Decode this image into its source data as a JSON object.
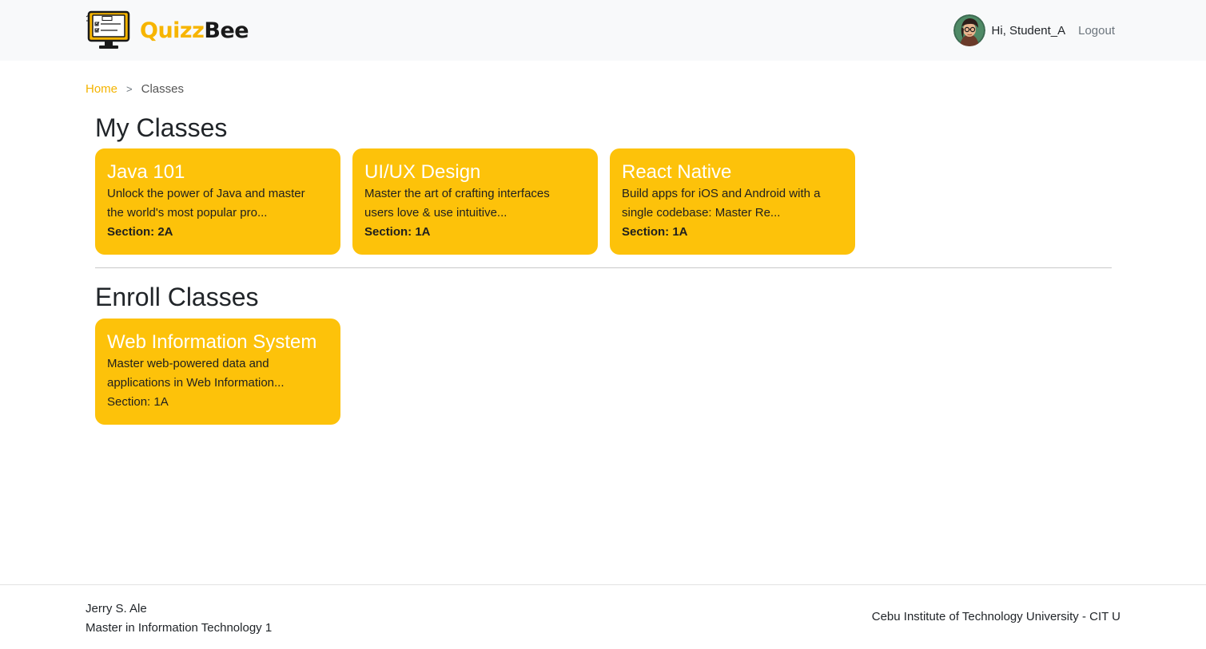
{
  "header": {
    "brand_part1": "Quizz",
    "brand_part2": "Bee",
    "greeting": "Hi, Student_A",
    "logout_label": "Logout"
  },
  "breadcrumb": {
    "home": "Home",
    "separator": ">",
    "current": "Classes"
  },
  "my_classes": {
    "title": "My Classes",
    "cards": [
      {
        "title": "Java 101",
        "line1": "Unlock the power of Java and master",
        "line2": "the world's most popular pro...",
        "section": "Section: 2A"
      },
      {
        "title": "UI/UX Design",
        "line1": "Master the art of crafting interfaces",
        "line2": "users love & use intuitive...",
        "section": "Section: 1A"
      },
      {
        "title": "React Native",
        "line1": "Build apps for iOS and Android with a",
        "line2": "single codebase: Master Re...",
        "section": "Section: 1A"
      }
    ]
  },
  "enroll_classes": {
    "title": "Enroll Classes",
    "cards": [
      {
        "title": "Web Information System",
        "line1": "Master web-powered data and",
        "line2": "applications in Web Information...",
        "section": "Section: 1A"
      }
    ]
  },
  "footer": {
    "name": "Jerry S. Ale",
    "program": "Master in Information Technology 1",
    "institution": "Cebu Institute of Technology University - CIT U"
  },
  "colors": {
    "accent": "#fdc20a",
    "brand_yellow": "#f7b500",
    "header_bg": "#f8f9fa"
  },
  "icons": {
    "logo": "quiz-monitor-icon",
    "avatar": "user-avatar"
  }
}
